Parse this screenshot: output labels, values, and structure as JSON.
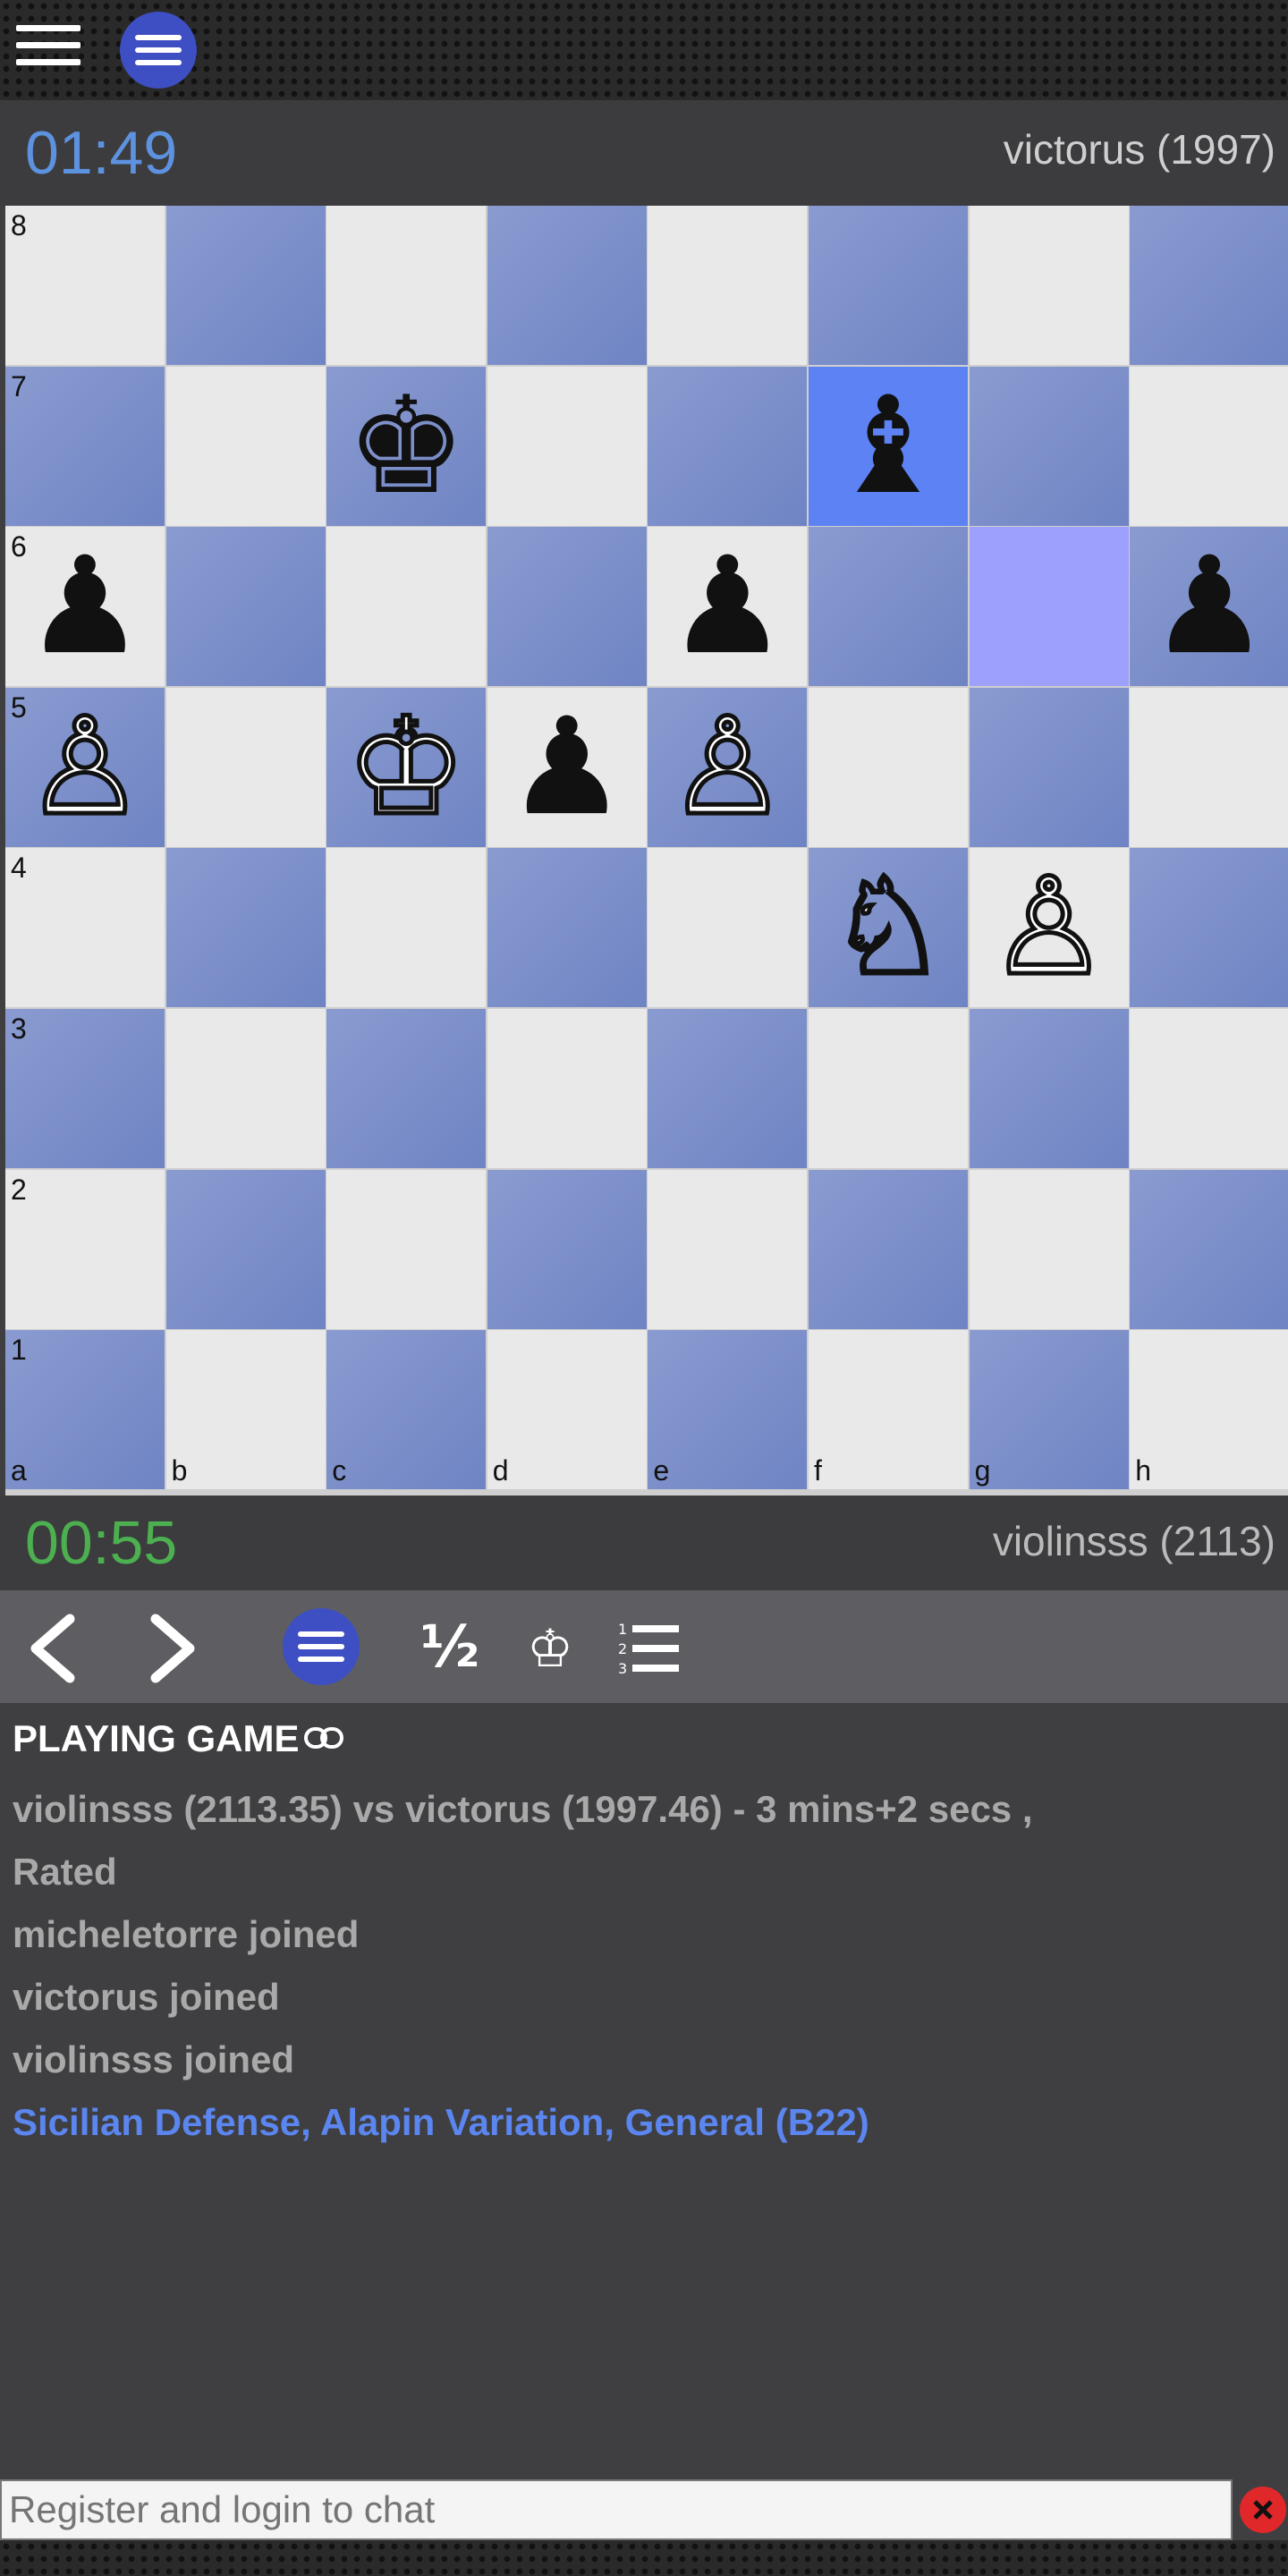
{
  "header": {
    "menu_icon": "hamburger-icon",
    "board_menu_icon": "menu-circle-icon"
  },
  "top_player": {
    "clock": "01:49",
    "name": "victorus (1997)"
  },
  "bottom_player": {
    "clock": "00:55",
    "name": "violinsss (2113)"
  },
  "board": {
    "ranks": [
      "8",
      "7",
      "6",
      "5",
      "4",
      "3",
      "2",
      "1"
    ],
    "files": [
      "a",
      "b",
      "c",
      "d",
      "e",
      "f",
      "g",
      "h"
    ],
    "highlight_from": "f7",
    "highlight_to": "g6",
    "pieces": [
      {
        "square": "c7",
        "color": "black",
        "type": "king",
        "glyph": "♚"
      },
      {
        "square": "f7",
        "color": "black",
        "type": "bishop",
        "glyph": "♝"
      },
      {
        "square": "a6",
        "color": "black",
        "type": "pawn",
        "glyph": "♟"
      },
      {
        "square": "e6",
        "color": "black",
        "type": "pawn",
        "glyph": "♟"
      },
      {
        "square": "h6",
        "color": "black",
        "type": "pawn",
        "glyph": "♟"
      },
      {
        "square": "a5",
        "color": "white",
        "type": "pawn",
        "glyph": "♙"
      },
      {
        "square": "c5",
        "color": "white",
        "type": "king",
        "glyph": "♔"
      },
      {
        "square": "d5",
        "color": "black",
        "type": "pawn",
        "glyph": "♟"
      },
      {
        "square": "e5",
        "color": "white",
        "type": "pawn",
        "glyph": "♙"
      },
      {
        "square": "f4",
        "color": "white",
        "type": "knight",
        "glyph": "♘"
      },
      {
        "square": "g4",
        "color": "white",
        "type": "pawn",
        "glyph": "♙"
      }
    ]
  },
  "controls": {
    "prev_icon": "chevron-left-icon",
    "next_icon": "chevron-right-icon",
    "menu_icon": "menu-circle-icon",
    "draw_label": "½",
    "offer_icon": "resign-icon",
    "moves_icon": "numbered-list-icon"
  },
  "info": {
    "title": "PLAYING GAME",
    "link_icon": "link-icon",
    "lines": [
      "violinsss (2113.35) vs victorus (1997.46) - 3 mins+2 secs ,",
      "Rated",
      "micheletorre joined",
      "victorus joined",
      "violinsss joined"
    ],
    "opening": "Sicilian Defense, Alapin Variation, General (B22)"
  },
  "chat": {
    "placeholder": "Register and login to chat",
    "close_icon": "close-icon"
  },
  "colors": {
    "light_square": "#e9e9e9",
    "dark_square": "#7a8dca",
    "highlight_from": "#5d82f4",
    "highlight_to": "#9da0fc",
    "top_clock": "#5d92e0",
    "bottom_clock": "#4caf50",
    "opening_link": "#5b86ef"
  }
}
